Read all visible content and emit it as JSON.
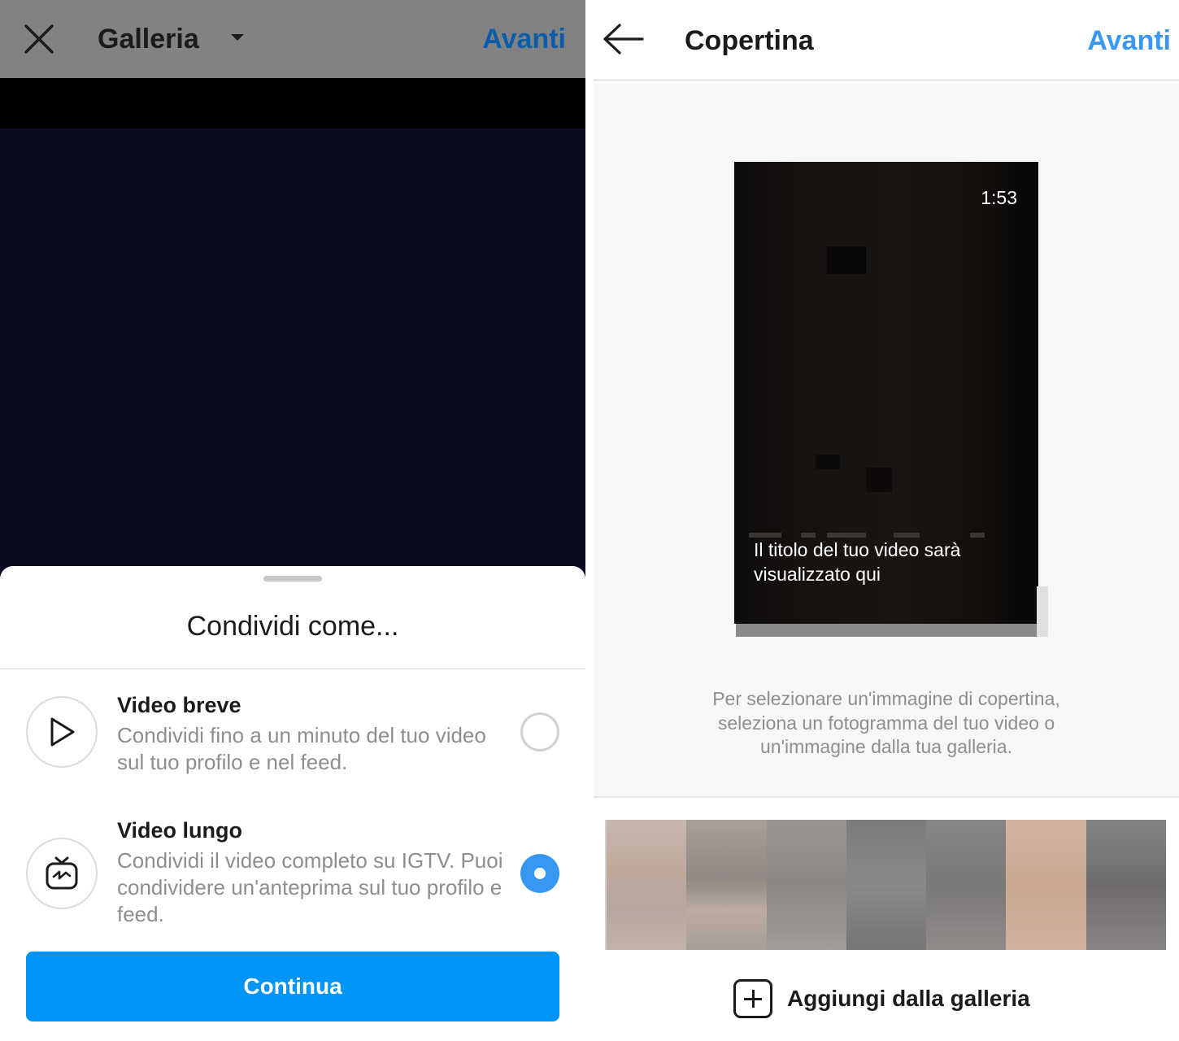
{
  "left_screen": {
    "header": {
      "close_icon": "close-icon",
      "title": "Galleria",
      "dropdown_icon": "caret-down-icon",
      "next_label": "Avanti"
    },
    "share_sheet": {
      "title": "Condividi come...",
      "options": [
        {
          "title": "Video breve",
          "description": "Condividi fino a un minuto del tuo video sul tuo profilo e nel feed.",
          "icon": "play-icon",
          "selected": false
        },
        {
          "title": "Video lungo",
          "description": "Condividi il video completo su IGTV. Puoi condividere un'anteprima sul tuo profilo e feed.",
          "icon": "igtv-icon",
          "selected": true
        }
      ],
      "continue_label": "Continua"
    }
  },
  "right_screen": {
    "header": {
      "back_icon": "back-arrow-icon",
      "title": "Copertina",
      "next_label": "Avanti"
    },
    "cover_preview": {
      "duration": "1:53",
      "title_placeholder": "Il titolo del tuo video sarà visualizzato qui"
    },
    "hint": "Per selezionare un'immagine di copertina, seleziona un fotogramma del tuo video o un'immagine dalla tua galleria.",
    "add_from_gallery_label": "Aggiungi dalla galleria",
    "add_icon": "plus-square-icon"
  },
  "colors": {
    "accent_blue": "#0095f6",
    "link_blue": "#3897f0",
    "dim_link_blue": "#0b5cab",
    "video_bg": "#0a0b21"
  }
}
